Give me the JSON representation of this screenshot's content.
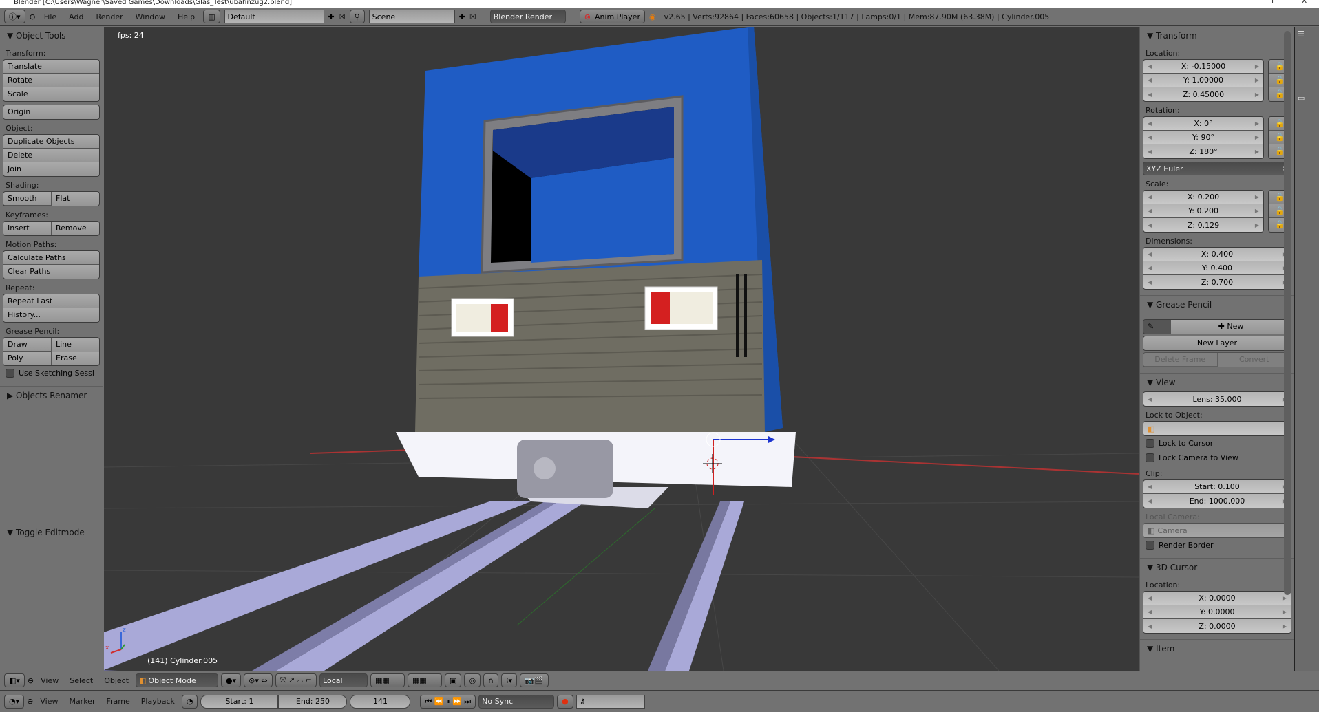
{
  "window": {
    "title": "Blender  [C:\\Users\\Wagner\\Saved Games\\Downloads\\Glas_Test\\ubahnzug2.blend]"
  },
  "topbar": {
    "menus": [
      "File",
      "Add",
      "Render",
      "Window",
      "Help"
    ],
    "screen_layout": "Default",
    "scene": "Scene",
    "render_engine": "Blender Render",
    "anim_player": "Anim Player",
    "status": "v2.65 | Verts:92864 | Faces:60658 | Objects:1/117 | Lamps:0/1 | Mem:87.90M (63.38M) | Cylinder.005"
  },
  "tool_shelf": {
    "title": "Object Tools",
    "transform_label": "Transform:",
    "transform": [
      "Translate",
      "Rotate",
      "Scale"
    ],
    "origin": "Origin",
    "object_label": "Object:",
    "object": [
      "Duplicate Objects",
      "Delete",
      "Join"
    ],
    "shading_label": "Shading:",
    "shading": [
      "Smooth",
      "Flat"
    ],
    "keyframes_label": "Keyframes:",
    "keyframes": [
      "Insert",
      "Remove"
    ],
    "motion_label": "Motion Paths:",
    "motion": [
      "Calculate Paths",
      "Clear Paths"
    ],
    "repeat_label": "Repeat:",
    "repeat": [
      "Repeat Last",
      "History..."
    ],
    "grease_label": "Grease Pencil:",
    "grease": [
      "Draw",
      "Line",
      "Poly",
      "Erase"
    ],
    "sketching": "Use Sketching Sessi",
    "renamer": "Objects Renamer",
    "toggle_editmode": "Toggle Editmode"
  },
  "viewport": {
    "fps": "fps: 24",
    "object_label": "(141) Cylinder.005",
    "axis_x": "x",
    "axis_z": "z"
  },
  "properties": {
    "transform_title": "Transform",
    "location_label": "Location:",
    "location": [
      "X: -0.15000",
      "Y: 1.00000",
      "Z: 0.45000"
    ],
    "rotation_label": "Rotation:",
    "rotation": [
      "X: 0°",
      "Y: 90°",
      "Z: 180°"
    ],
    "rotation_mode": "XYZ Euler",
    "scale_label": "Scale:",
    "scale": [
      "X: 0.200",
      "Y: 0.200",
      "Z: 0.129"
    ],
    "dimensions_label": "Dimensions:",
    "dimensions": [
      "X: 0.400",
      "Y: 0.400",
      "Z: 0.700"
    ],
    "grease_title": "Grease Pencil",
    "gp_new": "New",
    "gp_new_layer": "New Layer",
    "gp_delete_frame": "Delete Frame",
    "gp_convert": "Convert",
    "view_title": "View",
    "lens": "Lens: 35.000",
    "lock_to_object_label": "Lock to Object:",
    "lock_to_cursor": "Lock to Cursor",
    "lock_camera": "Lock Camera to View",
    "clip_label": "Clip:",
    "clip_start": "Start: 0.100",
    "clip_end": "End: 1000.000",
    "local_camera_label": "Local Camera:",
    "local_camera": "Camera",
    "render_border": "Render Border",
    "cursor_title": "3D Cursor",
    "cursor_location_label": "Location:",
    "cursor_location": [
      "X: 0.0000",
      "Y: 0.0000",
      "Z: 0.0000"
    ],
    "item_title": "Item"
  },
  "view3d_header": {
    "menus": [
      "View",
      "Select",
      "Object"
    ],
    "mode": "Object Mode",
    "orientation": "Local"
  },
  "timeline": {
    "menus": [
      "View",
      "Marker",
      "Frame",
      "Playback"
    ],
    "start": "Start: 1",
    "end": "End: 250",
    "current": "141",
    "sync": "No Sync"
  }
}
